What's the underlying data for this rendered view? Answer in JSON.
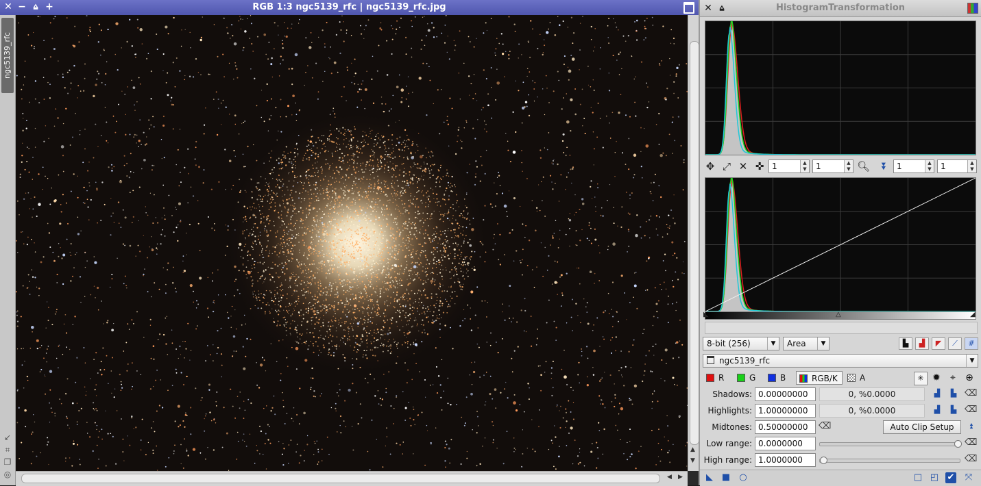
{
  "image_window": {
    "title": "RGB 1:3 ngc5139_rfc | ngc5139_rfc.jpg",
    "view_tab": "ngc5139_rfc"
  },
  "histogram_panel": {
    "title": "HistogramTransformation",
    "zoom": {
      "h1": "1",
      "v1": "1",
      "h2": "1",
      "v2": "1"
    },
    "resolution": "8-bit (256)",
    "graph_style": "Area",
    "view_selector": "ngc5139_rfc",
    "channels": [
      {
        "label": "R",
        "color": "#e01010"
      },
      {
        "label": "G",
        "color": "#18d018"
      },
      {
        "label": "B",
        "color": "#1030e0"
      },
      {
        "label": "RGB/K"
      },
      {
        "label": "A"
      }
    ],
    "shadows": {
      "label": "Shadows:",
      "value": "0.00000000",
      "info": "0, %0.0000"
    },
    "highlights": {
      "label": "Highlights:",
      "value": "1.00000000",
      "info": "0, %0.0000"
    },
    "midtones": {
      "label": "Midtones:",
      "value": "0.50000000"
    },
    "auto_clip_button": "Auto Clip Setup",
    "low_range": {
      "label": "Low range:",
      "value": "0.0000000"
    },
    "high_range": {
      "label": "High range:",
      "value": "1.0000000"
    }
  },
  "colors": {
    "title_accent": "#5a60b8",
    "panel_bg": "#d6d6d6"
  }
}
